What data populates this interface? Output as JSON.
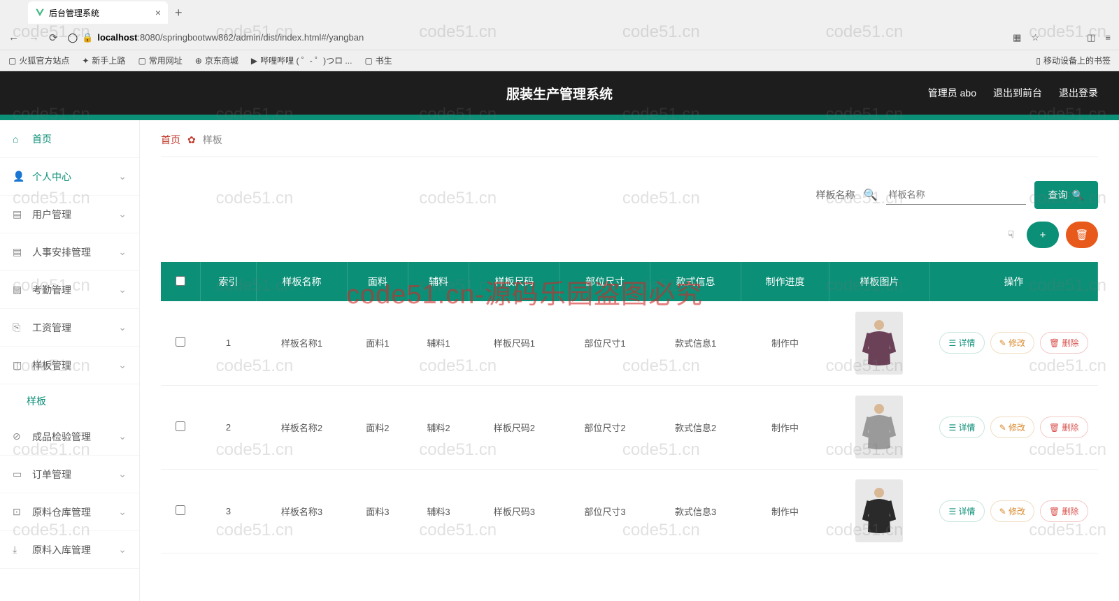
{
  "browser": {
    "tab_title": "后台管理系统",
    "url_host": "localhost",
    "url_path": ":8080/springbootww862/admin/dist/index.html#/yangban",
    "bookmarks": [
      "火狐官方站点",
      "新手上路",
      "常用网址",
      "京东商城",
      "哔哩哔哩 ( ゜- ゜)つロ ...",
      "书生"
    ],
    "mobile_bookmark": "移动设备上的书签"
  },
  "header": {
    "title": "服装生产管理系统",
    "user": "管理员 abo",
    "exit_front": "退出到前台",
    "logout": "退出登录"
  },
  "sidebar": {
    "items": [
      {
        "label": "首页",
        "icon": "home",
        "teal": true,
        "chev": false
      },
      {
        "label": "个人中心",
        "icon": "user",
        "teal": true,
        "chev": true
      },
      {
        "label": "用户管理",
        "icon": "users",
        "teal": false,
        "chev": true
      },
      {
        "label": "人事安排管理",
        "icon": "list",
        "teal": false,
        "chev": true
      },
      {
        "label": "考勤管理",
        "icon": "check",
        "teal": false,
        "chev": true
      },
      {
        "label": "工资管理",
        "icon": "money",
        "teal": false,
        "chev": true
      },
      {
        "label": "样板管理",
        "icon": "template",
        "teal": false,
        "chev": true
      },
      {
        "label": "成品检验管理",
        "icon": "check2",
        "teal": false,
        "chev": true
      },
      {
        "label": "订单管理",
        "icon": "order",
        "teal": false,
        "chev": true
      },
      {
        "label": "原料仓库管理",
        "icon": "warehouse",
        "teal": false,
        "chev": true
      },
      {
        "label": "原料入库管理",
        "icon": "inbox",
        "teal": false,
        "chev": true
      }
    ],
    "sub_item": "样板"
  },
  "breadcrumb": {
    "home": "首页",
    "current": "样板"
  },
  "filter": {
    "label": "样板名称",
    "placeholder": "样板名称",
    "query": "查询"
  },
  "table": {
    "headers": [
      "索引",
      "样板名称",
      "面料",
      "辅料",
      "样板尺码",
      "部位尺寸",
      "款式信息",
      "制作进度",
      "样板图片",
      "操作"
    ],
    "rows": [
      {
        "idx": "1",
        "name": "样板名称1",
        "fabric": "面料1",
        "aux": "辅料1",
        "size": "样板尺码1",
        "part": "部位尺寸1",
        "style": "款式信息1",
        "progress": "制作中"
      },
      {
        "idx": "2",
        "name": "样板名称2",
        "fabric": "面料2",
        "aux": "辅料2",
        "size": "样板尺码2",
        "part": "部位尺寸2",
        "style": "款式信息2",
        "progress": "制作中"
      },
      {
        "idx": "3",
        "name": "样板名称3",
        "fabric": "面料3",
        "aux": "辅料3",
        "size": "样板尺码3",
        "part": "部位尺寸3",
        "style": "款式信息3",
        "progress": "制作中"
      }
    ],
    "actions": {
      "detail": "详情",
      "edit": "修改",
      "delete": "删除"
    }
  },
  "watermark": {
    "small": "code51.cn",
    "big": "code51.cn-源码乐园盗图必究"
  }
}
